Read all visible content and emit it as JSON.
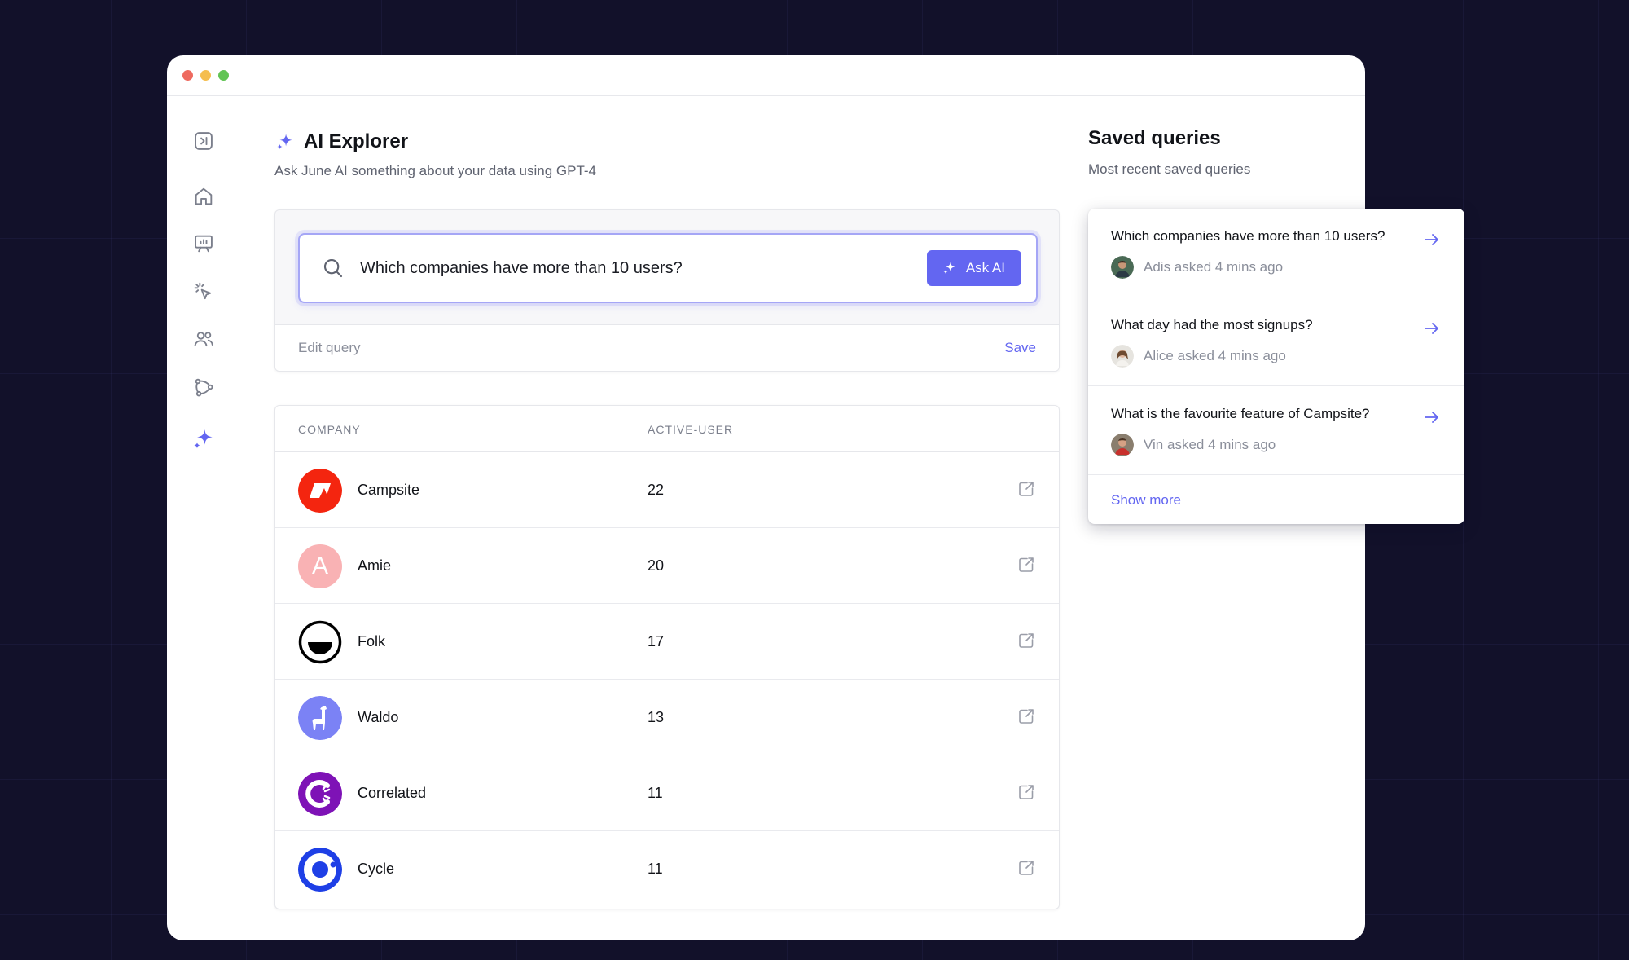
{
  "window": {
    "controls": [
      "close",
      "minimize",
      "maximize"
    ]
  },
  "sidebar": {
    "items": [
      {
        "name": "collapse-sidebar",
        "icon": "sidebar-toggle-icon"
      },
      {
        "name": "home",
        "icon": "home-icon"
      },
      {
        "name": "reports",
        "icon": "presentation-icon"
      },
      {
        "name": "events",
        "icon": "cursor-click-icon"
      },
      {
        "name": "users",
        "icon": "users-icon"
      },
      {
        "name": "companies",
        "icon": "connections-icon"
      },
      {
        "name": "ai-explorer",
        "icon": "sparkles-icon",
        "active": true
      }
    ]
  },
  "header": {
    "title": "AI Explorer",
    "subtitle": "Ask June AI something about your data using GPT-4"
  },
  "query": {
    "text": "Which companies have more than 10 users?",
    "ask_label": "Ask AI",
    "edit_label": "Edit query",
    "save_label": "Save"
  },
  "table": {
    "columns": [
      "COMPANY",
      "ACTIVE-USER"
    ],
    "rows": [
      {
        "company": "Campsite",
        "active_users": "22",
        "logo": "campsite"
      },
      {
        "company": "Amie",
        "active_users": "20",
        "logo": "amie",
        "initial": "A"
      },
      {
        "company": "Folk",
        "active_users": "17",
        "logo": "folk"
      },
      {
        "company": "Waldo",
        "active_users": "13",
        "logo": "waldo"
      },
      {
        "company": "Correlated",
        "active_users": "11",
        "logo": "correlated"
      },
      {
        "company": "Cycle",
        "active_users": "11",
        "logo": "cycle"
      }
    ]
  },
  "saved": {
    "title": "Saved queries",
    "subtitle": "Most recent saved queries",
    "items": [
      {
        "question": "Which companies have more than 10 users?",
        "meta": "Adis asked 4 mins ago"
      },
      {
        "question": "What day had the most signups?",
        "meta": "Alice asked 4 mins ago"
      },
      {
        "question": "What is the favourite feature of Campsite?",
        "meta": "Vin asked 4 mins ago"
      }
    ],
    "show_more": "Show more"
  },
  "colors": {
    "accent": "#6366f1",
    "background": "#12112a",
    "campsite": "#f4250f",
    "amie": "#f9b2b4",
    "waldo": "#7b82f5",
    "correlated": "#7e12b6",
    "cycle": "#1e3fe6"
  }
}
